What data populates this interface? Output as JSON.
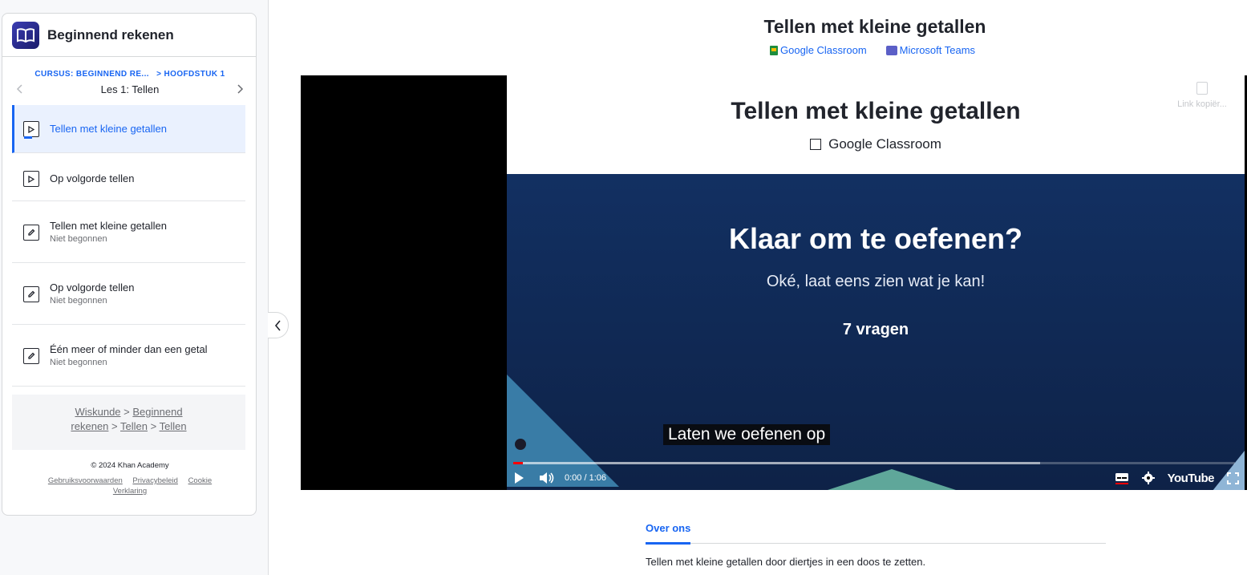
{
  "sidebar": {
    "course_title": "Beginnend rekenen",
    "breadcrumb_course": "CURSUS: BEGINNEND RE...",
    "breadcrumb_chapter": "> HOOFDSTUK 1",
    "lesson_title": "Les 1: Tellen",
    "items": [
      {
        "title": "Tellen met kleine getallen",
        "subtitle": "",
        "type": "video",
        "active": true
      },
      {
        "title": "Op volgorde tellen",
        "subtitle": "",
        "type": "video",
        "active": false
      },
      {
        "title": "Tellen met kleine getallen",
        "subtitle": "Niet begonnen",
        "type": "exercise",
        "active": false
      },
      {
        "title": "Op volgorde tellen",
        "subtitle": "Niet begonnen",
        "type": "exercise",
        "active": false
      },
      {
        "title": "Één meer of minder dan een getal",
        "subtitle": "Niet begonnen",
        "type": "exercise",
        "active": false
      }
    ],
    "bottom_breadcrumbs": {
      "wiskunde": "Wiskunde",
      "beginnend": "Beginnend",
      "rekenen": "rekenen",
      "tellen1": "Tellen",
      "tellen2": "Tellen",
      "sep": ">"
    },
    "footer": {
      "copyright": "© 2024 Khan Academy",
      "terms": "Gebruiksvoorwaarden",
      "privacy": "Privacybeleid",
      "cookie": "Cookie",
      "statement": "Verklaring"
    }
  },
  "main": {
    "title": "Tellen met kleine getallen",
    "share_google": "Google Classroom",
    "share_teams": "Microsoft Teams",
    "video": {
      "frame_title": "Tellen met kleine getallen",
      "frame_google": "Google Classroom",
      "copy_link": "Link kopiër...",
      "headline": "Klaar om te oefenen?",
      "subline": "Oké, laat eens zien wat je kan!",
      "questions": "7 vragen",
      "caption": "Laten we oefenen op",
      "time": "0:00 / 1:06",
      "progress": 0.0,
      "buffered": 0.73,
      "youtube": "YouTube"
    },
    "tab_label": "Over ons",
    "description": "Tellen met kleine getallen door diertjes in een doos te zetten."
  },
  "colors": {
    "accent": "#1865f2",
    "video_bg": "#123062",
    "progress_red": "#ff0000"
  }
}
